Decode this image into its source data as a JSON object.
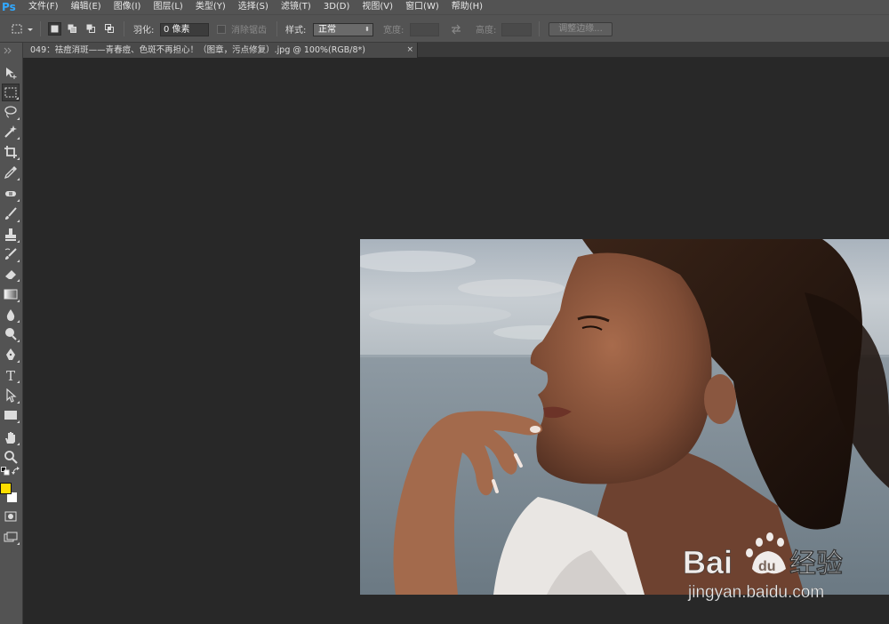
{
  "app": {
    "logo": "Ps"
  },
  "menu": [
    "文件(F)",
    "编辑(E)",
    "图像(I)",
    "图层(L)",
    "类型(Y)",
    "选择(S)",
    "滤镜(T)",
    "3D(D)",
    "视图(V)",
    "窗口(W)",
    "帮助(H)"
  ],
  "options": {
    "feather_label": "羽化:",
    "feather_value": "0 像素",
    "antialias_label": "消除锯齿",
    "style_label": "样式:",
    "style_value": "正常",
    "width_label": "宽度:",
    "height_label": "高度:",
    "refine_edge_label": "调整边缘..."
  },
  "document": {
    "tab_title": "049：祛痘消斑——青春痘、色斑不再担心！（图章，污点修复）.jpg @ 100%(RGB/8*)",
    "close_symbol": "×"
  },
  "colors": {
    "foreground": "#ffde00",
    "background": "#ffffff",
    "accent": "#31a8ff"
  },
  "tools": [
    "move-tool",
    "rectangular-marquee-tool",
    "lasso-tool",
    "magic-wand-tool",
    "crop-tool",
    "eyedropper-tool",
    "spot-healing-brush-tool",
    "brush-tool",
    "clone-stamp-tool",
    "history-brush-tool",
    "eraser-tool",
    "gradient-tool",
    "blur-tool",
    "dodge-tool",
    "pen-tool",
    "type-tool",
    "path-selection-tool",
    "rectangle-tool",
    "hand-tool",
    "zoom-tool"
  ],
  "watermark": {
    "brand_text": "Bai",
    "brand_text2": "经验",
    "url": "jingyan.baidu.com"
  }
}
